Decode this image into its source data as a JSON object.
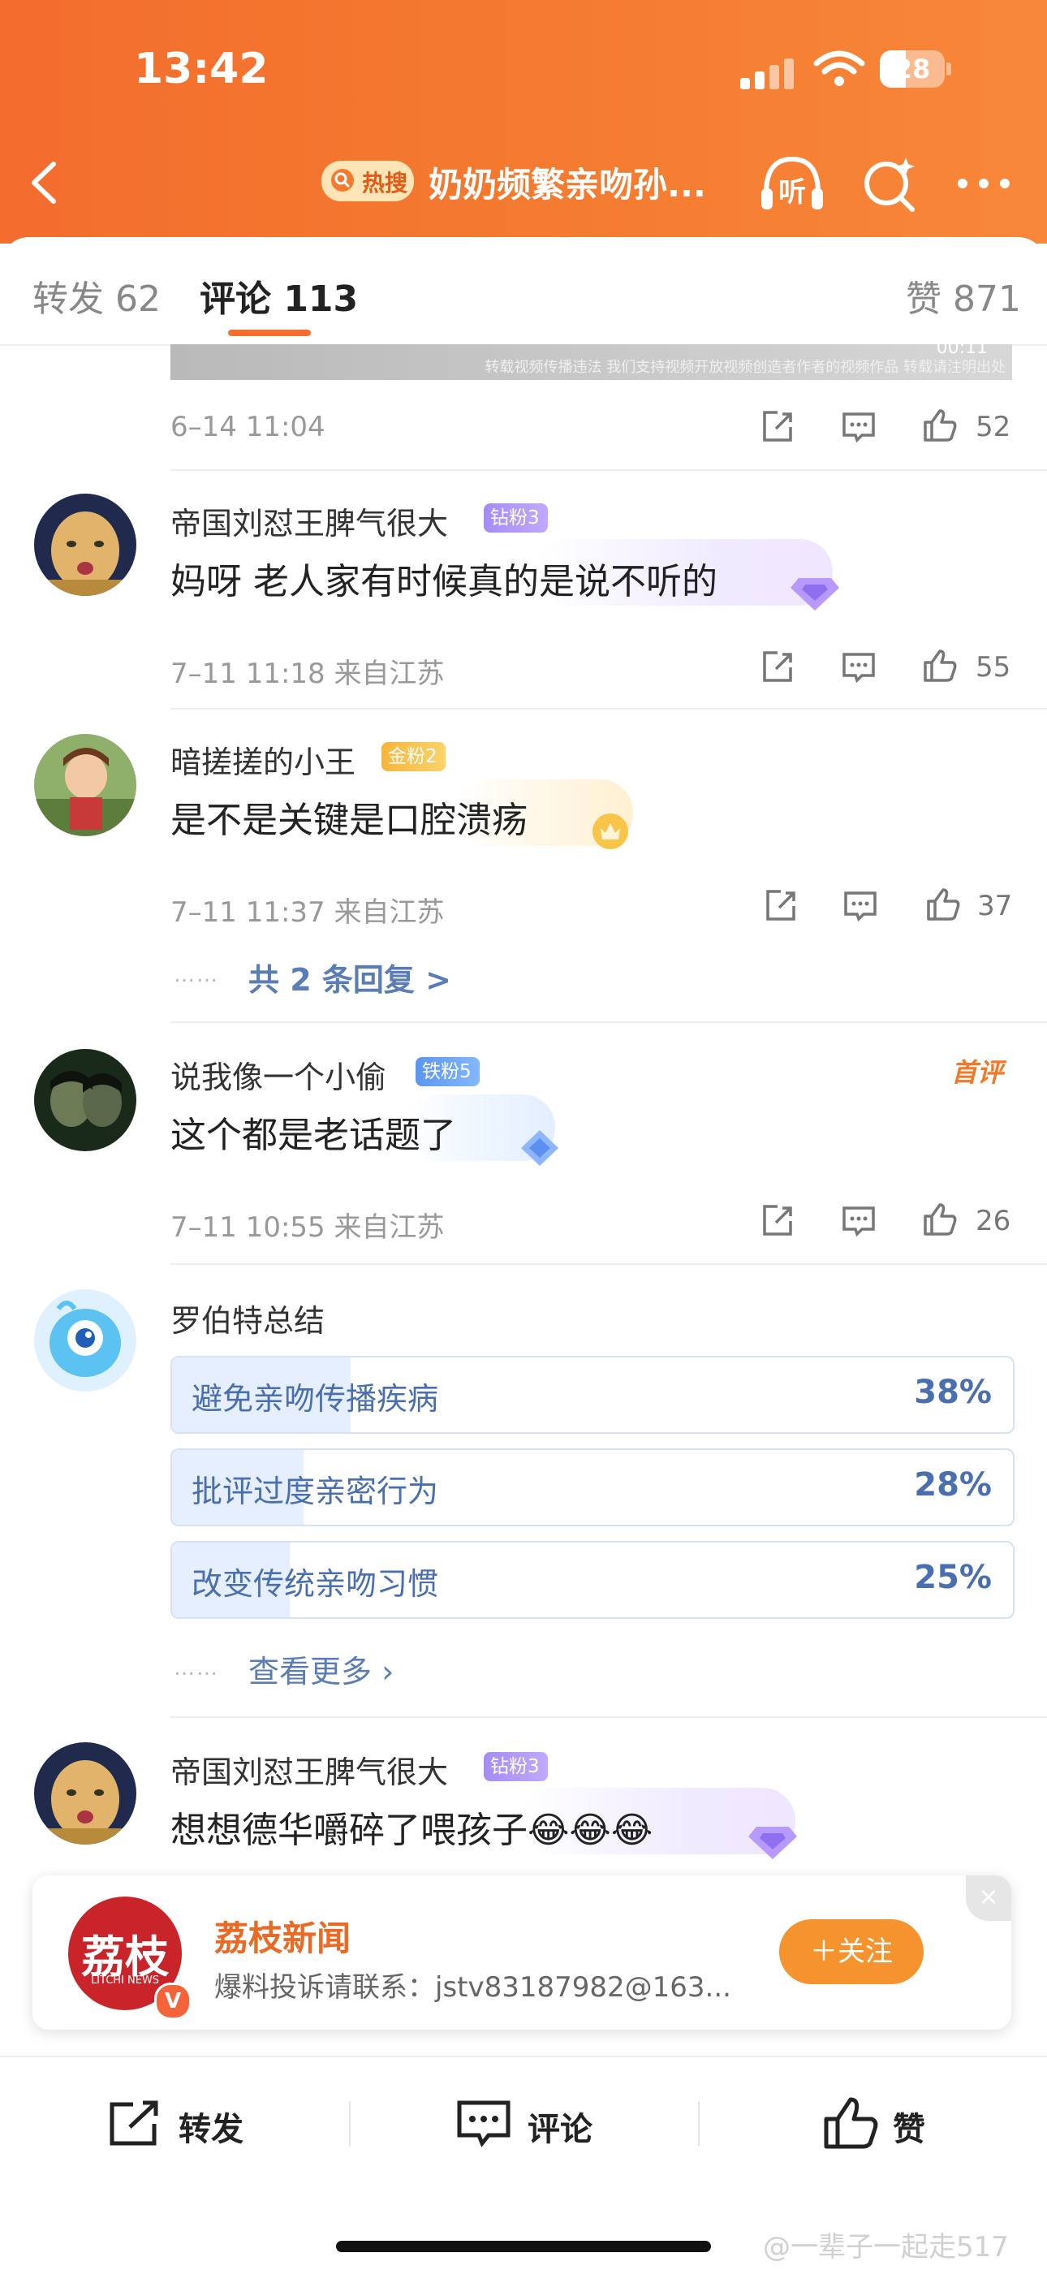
{
  "status_bar": {
    "time": "13:42",
    "battery": "28"
  },
  "header": {
    "hot_badge": "热搜",
    "title": "奶奶频繁亲吻孙...",
    "listen_label": "听"
  },
  "tabs": {
    "repost": "转发 62",
    "comments": "评论 113",
    "likes": "赞 871"
  },
  "media_caption": "转载视频传播违法 我们支持视频开放视频创造者作者的视频作品 转载请注明出处",
  "media_duration": "00:11",
  "comments": [
    {
      "meta": "6–14 11:04",
      "likes": "52"
    },
    {
      "user": "帝国刘怼王脾气很大",
      "badge": "钻粉3",
      "text": "妈呀 老人家有时候真的是说不听的",
      "meta": "7–11 11:18  来自江苏",
      "likes": "55"
    },
    {
      "user": "暗搓搓的小王",
      "badge": "金粉2",
      "text": "是不是关键是口腔溃疡",
      "meta": "7–11 11:37  来自江苏",
      "likes": "37",
      "replies": "共 2 条回复 >"
    },
    {
      "user": "说我像一个小偷",
      "badge": "铁粉5",
      "tag": "首评",
      "text": "这个都是老话题了",
      "meta": "7–11 10:55  来自江苏",
      "likes": "26"
    },
    {
      "user": "帝国刘怼王脾气很大",
      "badge": "钻粉3",
      "text": "想想德华嚼碎了喂孩子😂😂😂"
    }
  ],
  "poll": {
    "author": "罗伯特总结",
    "options": [
      {
        "label": "避免亲吻传播疾病",
        "pct": "38%",
        "value": 0.38
      },
      {
        "label": "批评过度亲密行为",
        "pct": "28%",
        "value": 0.28
      },
      {
        "label": "改变传统亲吻习惯",
        "pct": "25%",
        "value": 0.25
      }
    ],
    "more": "查看更多 ›"
  },
  "dots": "……",
  "news_card": {
    "logo_cn": "荔枝",
    "logo_en": "LITCHI NEWS",
    "name": "荔枝新闻",
    "desc": "爆料投诉请联系：jstv83187982@163...",
    "follow": "＋关注",
    "close": "×"
  },
  "bottom_bar": {
    "repost": "转发",
    "comment": "评论",
    "like": "赞"
  },
  "watermark": "@一辈子一起走517",
  "colors": {
    "accent": "#f56e2f",
    "link": "#5a7db5"
  }
}
